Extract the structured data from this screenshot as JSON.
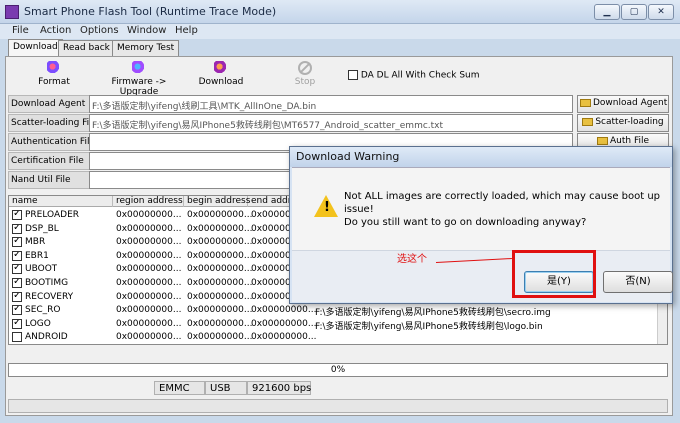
{
  "window": {
    "title": "Smart Phone Flash Tool (Runtime Trace Mode)"
  },
  "menu": [
    "File",
    "Action",
    "Options",
    "Window",
    "Help"
  ],
  "tabs": [
    "Download",
    "Read back",
    "Memory Test"
  ],
  "toolbar": {
    "format": "Format",
    "upgrade": "Firmware -> Upgrade",
    "download": "Download",
    "stop": "Stop",
    "da_check": "DA DL All With Check Sum"
  },
  "fields": {
    "download_agent": {
      "label": "Download Agent",
      "value": "F:\\多语版定制\\yifeng\\线刷工具\\MTK_AllInOne_DA.bin"
    },
    "scatter": {
      "label": "Scatter-loading File",
      "value": "F:\\多语版定制\\yifeng\\易风IPhone5救砖线刷包\\MT6577_Android_scatter_emmc.txt"
    },
    "auth": {
      "label": "Authentication File",
      "value": ""
    },
    "cert": {
      "label": "Certification File",
      "value": ""
    },
    "nand": {
      "label": "Nand Util File",
      "value": ""
    }
  },
  "side_buttons": {
    "da": "Download Agent",
    "scatter": "Scatter-loading",
    "auth": "Auth File"
  },
  "table": {
    "headers": [
      "name",
      "region address",
      "begin address",
      "end addre"
    ],
    "rows": [
      {
        "name": "PRELOADER",
        "checked": true,
        "region": "0x00000000...",
        "begin": "0x00000000...",
        "end": "0x00000000",
        "path": ""
      },
      {
        "name": "DSP_BL",
        "checked": true,
        "region": "0x00000000...",
        "begin": "0x00000000...",
        "end": "0x00000000",
        "path": ""
      },
      {
        "name": "MBR",
        "checked": true,
        "region": "0x00000000...",
        "begin": "0x00000000...",
        "end": "0x00000000",
        "path": ""
      },
      {
        "name": "EBR1",
        "checked": true,
        "region": "0x00000000...",
        "begin": "0x00000000...",
        "end": "0x00000000",
        "path": ""
      },
      {
        "name": "UBOOT",
        "checked": true,
        "region": "0x00000000...",
        "begin": "0x00000000...",
        "end": "0x00000000",
        "path": ""
      },
      {
        "name": "BOOTIMG",
        "checked": true,
        "region": "0x00000000...",
        "begin": "0x00000000...",
        "end": "0x00000000",
        "path": ""
      },
      {
        "name": "RECOVERY",
        "checked": true,
        "region": "0x00000000...",
        "begin": "0x00000000...",
        "end": "0x00000000",
        "path": ""
      },
      {
        "name": "SEC_RO",
        "checked": true,
        "region": "0x00000000...",
        "begin": "0x00000000...",
        "end": "0x00000000...",
        "path": "F:\\多语版定制\\yifeng\\易风IPhone5救砖线刷包\\secro.img"
      },
      {
        "name": "LOGO",
        "checked": true,
        "region": "0x00000000...",
        "begin": "0x00000000...",
        "end": "0x00000000...",
        "path": "F:\\多语版定制\\yifeng\\易风IPhone5救砖线刷包\\logo.bin"
      },
      {
        "name": "ANDROID",
        "checked": false,
        "region": "0x00000000...",
        "begin": "0x00000000...",
        "end": "0x00000000...",
        "path": ""
      }
    ]
  },
  "progress": {
    "label": "0%",
    "value": 0
  },
  "status": {
    "storage": "EMMC",
    "port": "USB",
    "baud": "921600 bps"
  },
  "dialog": {
    "title": "Download Warning",
    "message_line1": "Not ALL images are correctly loaded, which may cause boot up issue!",
    "message_line2": "Do you still want to go on downloading anyway?",
    "yes": "是(Y)",
    "no": "否(N)"
  },
  "annotation": {
    "text": "选这个",
    "color": "#e01010"
  }
}
